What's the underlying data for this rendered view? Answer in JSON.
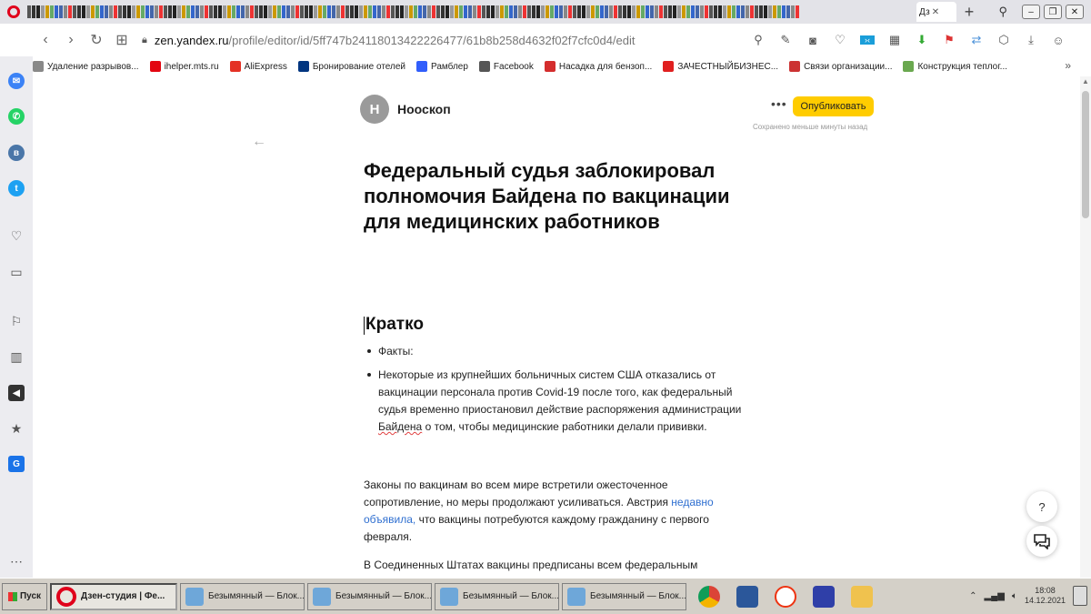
{
  "browser": {
    "active_tab_label": "Дз",
    "url_domain": "zen.yandex.ru",
    "url_path": "/profile/editor/id/5ff747b24118013422226477/61b8b258d4632f02f7cfc0d4/edit",
    "bookmarks": [
      {
        "label": "Удаление разрывов...",
        "color": "#888888"
      },
      {
        "label": "ihelper.mts.ru",
        "color": "#e30611"
      },
      {
        "label": "AliExpress",
        "color": "#e43225"
      },
      {
        "label": "Бронирование отелей",
        "color": "#003580"
      },
      {
        "label": "Рамблер",
        "color": "#315efb"
      },
      {
        "label": "Facebook",
        "color": "#555555"
      },
      {
        "label": "Насадка для бензоп...",
        "color": "#d42d2d"
      },
      {
        "label": "ЗАЧЕСТНЫЙБИЗНЕС...",
        "color": "#e02020"
      },
      {
        "label": "Связи организации...",
        "color": "#cc3333"
      },
      {
        "label": "Конструкция теплог...",
        "color": "#6aa84f"
      }
    ]
  },
  "editor": {
    "avatar_letter": "Н",
    "channel_name": "Нооскоп",
    "publish_label": "Опубликовать",
    "saved_status": "Сохранено меньше минуты назад"
  },
  "article": {
    "title": "Федеральный судья заблокировал полномочия Байдена по вакцинации  для медицинских работников",
    "section_heading": "Кратко",
    "bullet_facts": "Факты:",
    "bullet_main_pre": "Некоторые из крупнейших больничных систем США отказались от вакцинации персонала против Covid-19 после того, как федеральный судья временно приостановил действие распоряжения администрации ",
    "bullet_main_underlined": "Байдена",
    "bullet_main_post": " о том, чтобы медицинские работники делали прививки.",
    "para1_pre": "Законы по вакцинам во всем мире встретили ожесточенное сопротивление, но меры продолжают усиливаться. Австрия ",
    "para1_link": "недавно объявила,",
    "para1_post": " что вакцины потребуются каждому гражданину с первого февраля.",
    "para2": "В Соединенных Штатах вакцины предписаны всем федеральным"
  },
  "floating": {
    "help_label": "?"
  },
  "taskbar": {
    "start_label": "Пуск",
    "tasks": [
      {
        "label": "Дзен-студия | Фе..."
      },
      {
        "label": "Безымянный — Блок..."
      },
      {
        "label": "Безымянный — Блок..."
      },
      {
        "label": "Безымянный — Блок..."
      },
      {
        "label": "Безымянный — Блок..."
      }
    ],
    "clock_time": "18:08",
    "clock_date": "14.12.2021"
  },
  "colors": {
    "publish_button": "#ffcc00",
    "link": "#2f6fd0",
    "opera_red": "#e0001b"
  }
}
